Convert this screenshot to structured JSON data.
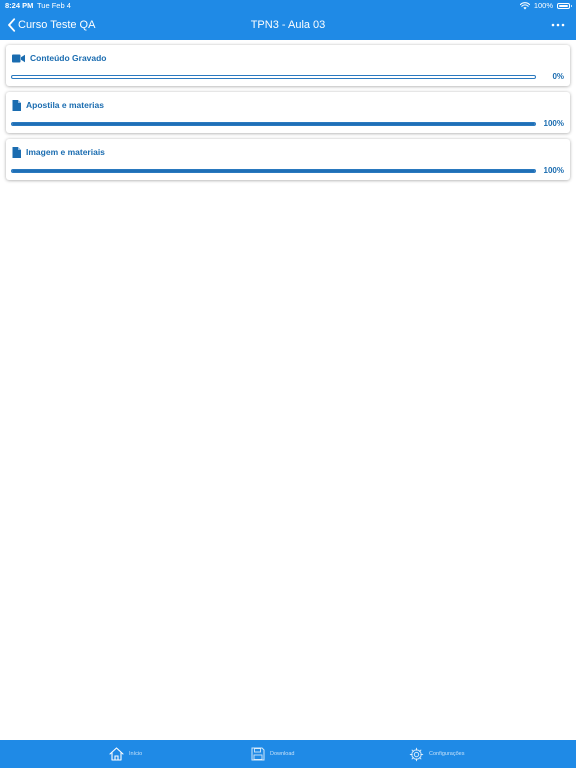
{
  "status_bar": {
    "time": "8:24 PM",
    "date": "Tue Feb 4",
    "battery": "100%"
  },
  "nav": {
    "back_label": "Curso Teste QA",
    "title": "TPN3 - Aula 03",
    "back_icon": "chevron-left-icon",
    "more_icon": "more-horizontal-icon"
  },
  "items": [
    {
      "title": "Conteúdo Gravado",
      "icon": "video-camera-icon",
      "progress": 0,
      "progress_label": "0%"
    },
    {
      "title": "Apostila e materias",
      "icon": "document-icon",
      "progress": 100,
      "progress_label": "100%"
    },
    {
      "title": "Imagem e materiais",
      "icon": "document-icon",
      "progress": 100,
      "progress_label": "100%"
    }
  ],
  "tabs": [
    {
      "label": "Início",
      "icon": "home-icon"
    },
    {
      "label": "Download",
      "icon": "floppy-disk-icon"
    },
    {
      "label": "Configurações",
      "icon": "gear-icon"
    }
  ],
  "colors": {
    "primary": "#1f8ae6",
    "accent_text": "#1a6cb0",
    "progress_fill": "#1f6fb6"
  }
}
